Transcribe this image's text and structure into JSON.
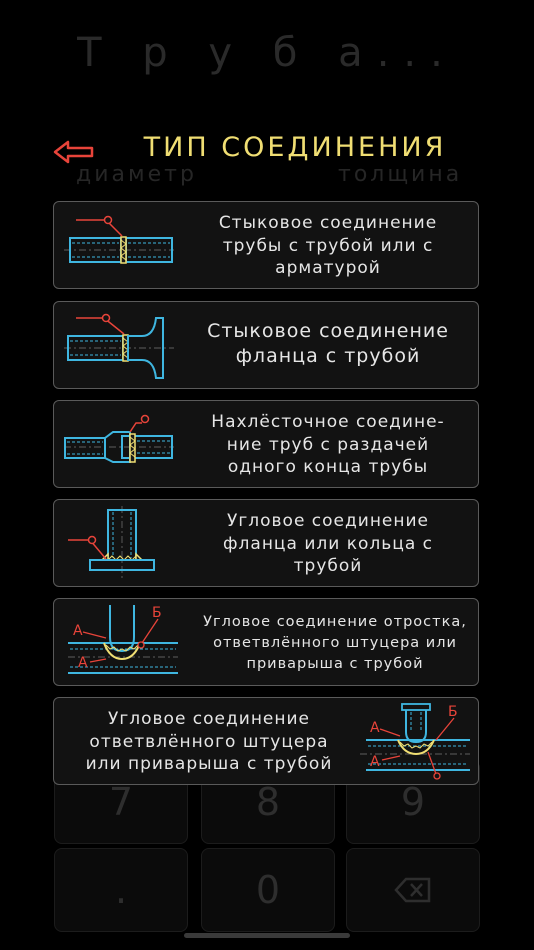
{
  "background": {
    "title": "Т р у б а...",
    "diameter_label": "диаметр",
    "thickness_label": "толщина",
    "keys": [
      "7",
      "8",
      "9",
      ".",
      "0"
    ]
  },
  "header": {
    "title": "ТИП СОЕДИНЕНИЯ"
  },
  "connection_types": [
    {
      "label": "Стыковое соединение\nтрубы с трубой или с\nарматурой"
    },
    {
      "label": "Стыковое соединение\nфланца с трубой"
    },
    {
      "label": "Нахлёсточное соедине-\nние труб с раздачей\nодного конца трубы"
    },
    {
      "label": "Угловое соединение\nфланца или кольца с\nтрубой"
    },
    {
      "label": "Угловое соединение отростка,\nответвлённого штуцера или\nприварыша с трубой",
      "mark_a": "А",
      "mark_b": "Б"
    },
    {
      "label": "Угловое соединение\nответвлённого штуцера\nили приварыша с трубой",
      "mark_a": "А",
      "mark_b": "Б"
    }
  ],
  "colors": {
    "accent": "#f0de73",
    "back_arrow": "#e8443a",
    "pipe": "#3fb6e0",
    "weld": "#f0de73",
    "leader": "#e8443a",
    "card_border": "#5a5a5a"
  }
}
